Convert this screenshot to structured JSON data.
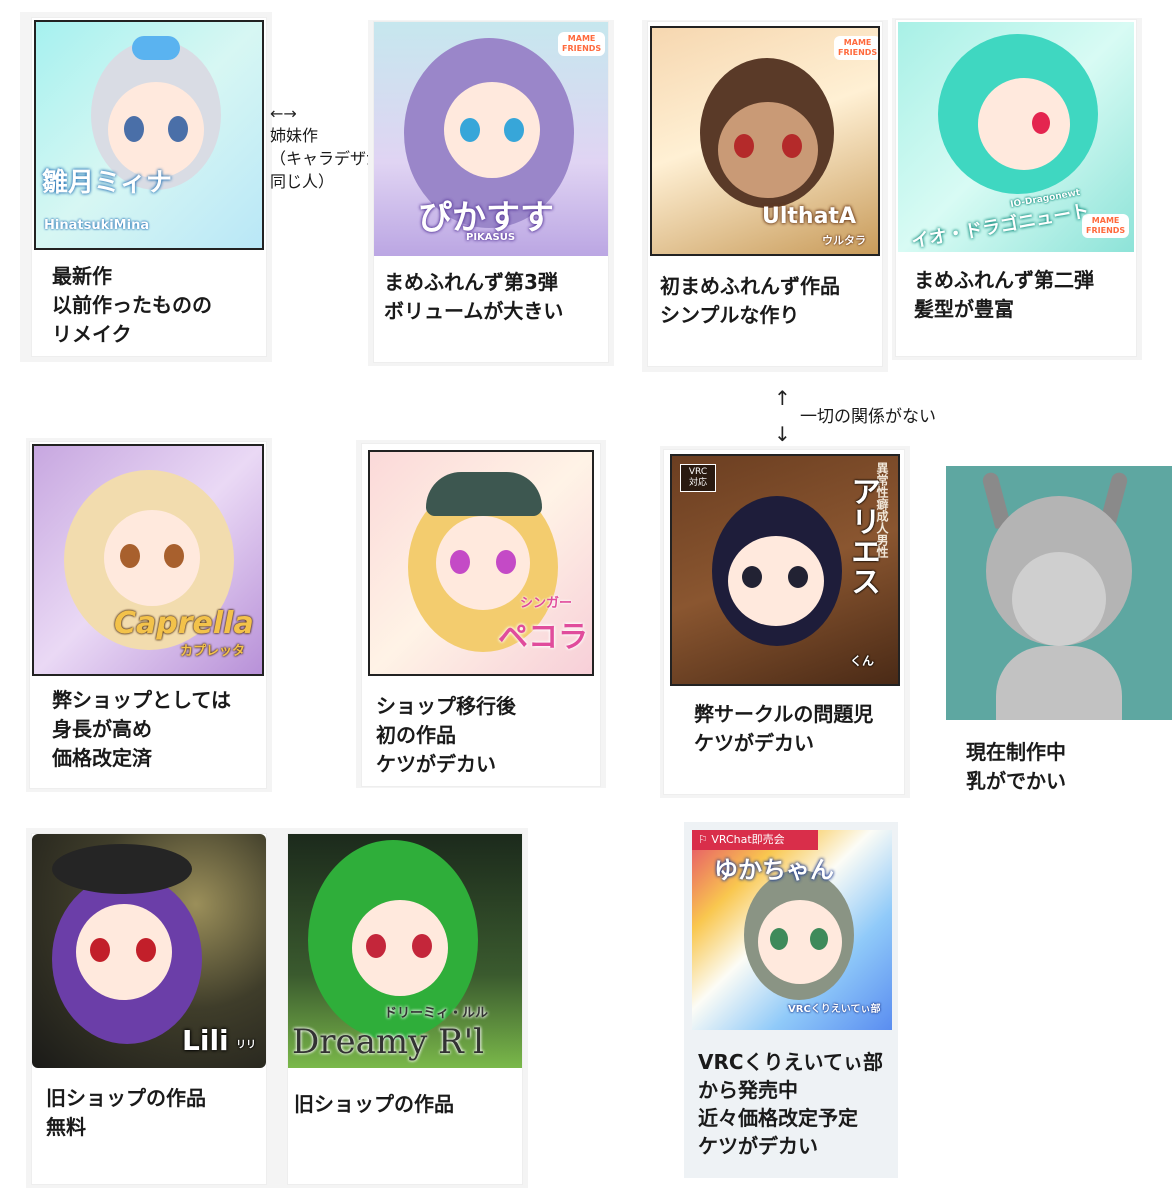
{
  "items": [
    {
      "logo": "雛月ミィナ",
      "logo_sub": "HinatsukiMina",
      "caption": "最新作\n以前作ったものの\nリメイク"
    },
    {
      "logo": "ぴかすす",
      "logo_sub": "PIKASUS",
      "caption": "まめふれんず第3弾\nボリュームが大きい"
    },
    {
      "logo": "UlthatA",
      "logo_sub": "ウルタラ",
      "caption": "初まめふれんず作品\nシンプルな作り"
    },
    {
      "logo": "イオ・ドラゴニュート",
      "logo_sub": "IO-Dragonewt",
      "caption": "まめふれんず第二弾\n髪型が豊富"
    },
    {
      "logo": "Caprella",
      "logo_sub": "カプレッタ",
      "caption": "弊ショップとしては\n身長が高め\n価格改定済"
    },
    {
      "logo": "ペコラ",
      "logo_sub": "シンガー",
      "caption": "ショップ移行後\n初の作品\nケツがデカい"
    },
    {
      "logo": "アリエス",
      "logo_sub": "くん",
      "vertical": "異常性癖成人男性",
      "badge": "VRC\n対応",
      "caption": "弊サークルの問題児\nケツがデカい"
    },
    {
      "caption": "現在制作中\n乳がでかい"
    },
    {
      "logo": "Lili",
      "logo_sub": "リリ",
      "caption": "旧ショップの作品\n無料"
    },
    {
      "logo": "Dreamy R'l",
      "logo_sub": "ドリーミィ・ルル",
      "caption": "旧ショップの作品"
    },
    {
      "logo": "ゆかちゃん",
      "logo_sub": "VRCくりえいてぃ部",
      "banner": "VRChat即売会",
      "caption": "VRCくりえいてぃ部\nから発売中\n近々価格改定予定\nケツがデカい"
    }
  ],
  "notes": {
    "sister": {
      "arrow": "←→",
      "text": "姉妹作\n（キャラデザが\n同じ人）"
    },
    "unrelated": {
      "arrow_up": "↑",
      "arrow_down": "↓",
      "text": "一切の関係がない"
    }
  },
  "badges": {
    "mame": "MAME",
    "mame_sub": "FRIENDS"
  },
  "colors": {
    "accent": "#5a3b9c",
    "card_border": "#eeeeee"
  }
}
